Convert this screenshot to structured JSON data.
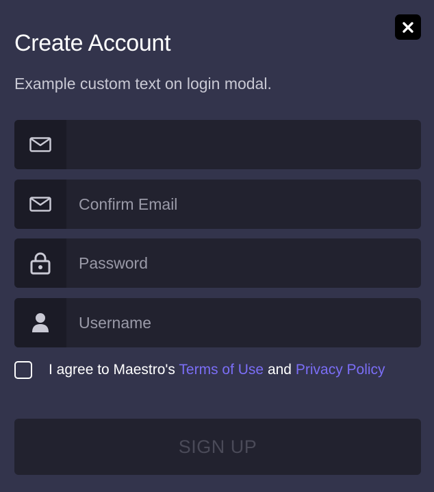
{
  "modal": {
    "title": "Create Account",
    "subtitle": "Example custom text on login modal."
  },
  "close_button": {
    "icon": "close-icon"
  },
  "fields": {
    "email": {
      "icon": "mail-icon",
      "placeholder": "",
      "value": ""
    },
    "confirm_email": {
      "icon": "mail-icon",
      "placeholder": "Confirm Email",
      "value": ""
    },
    "password": {
      "icon": "lock-icon",
      "placeholder": "Password",
      "value": ""
    },
    "username": {
      "icon": "user-icon",
      "placeholder": "Username",
      "value": ""
    }
  },
  "agreement": {
    "checked": false,
    "prefix": "I agree to Maestro's",
    "terms_link": "Terms of Use",
    "connector": "and",
    "privacy_link": "Privacy Policy"
  },
  "signup_button": {
    "label": "SIGN UP",
    "enabled": false
  },
  "colors": {
    "background": "#33344c",
    "field_background": "#22222f",
    "icon_box_background": "#1b1b26",
    "link": "#7b6ef6",
    "close_button_background": "#000000"
  }
}
